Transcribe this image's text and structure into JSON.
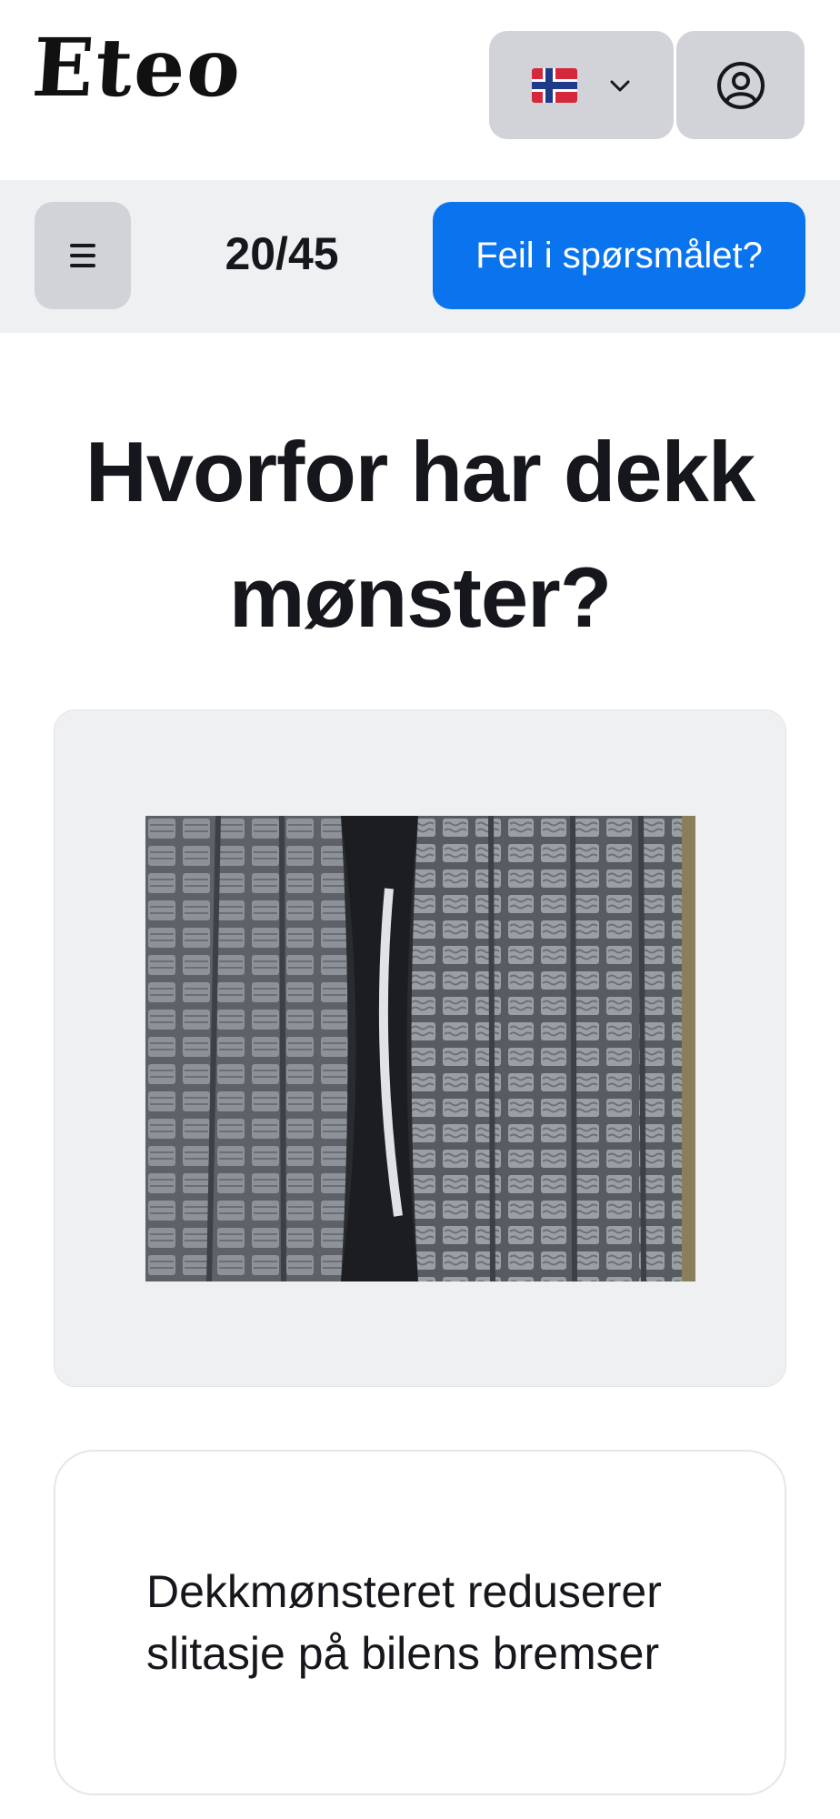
{
  "header": {
    "logo": "Eteo",
    "language": {
      "flag_icon": "norway-flag-icon",
      "chevron_icon": "chevron-down-icon"
    },
    "profile_icon": "user-circle-icon"
  },
  "toolbar": {
    "menu_icon": "hamburger-menu-icon",
    "counter": "20/45",
    "report_label": "Feil i spørsmålet?"
  },
  "question": {
    "text": "Hvorfor har dekk mønster?"
  },
  "image": {
    "subject": "tire-tread-photo"
  },
  "answers": [
    {
      "text": "Dekkmønsteret reduserer slitasje på bilens bremser"
    }
  ],
  "colors": {
    "accent": "#0a74ee",
    "button_gray": "#d1d3d8",
    "toolbar_bg": "#eff0f2"
  }
}
